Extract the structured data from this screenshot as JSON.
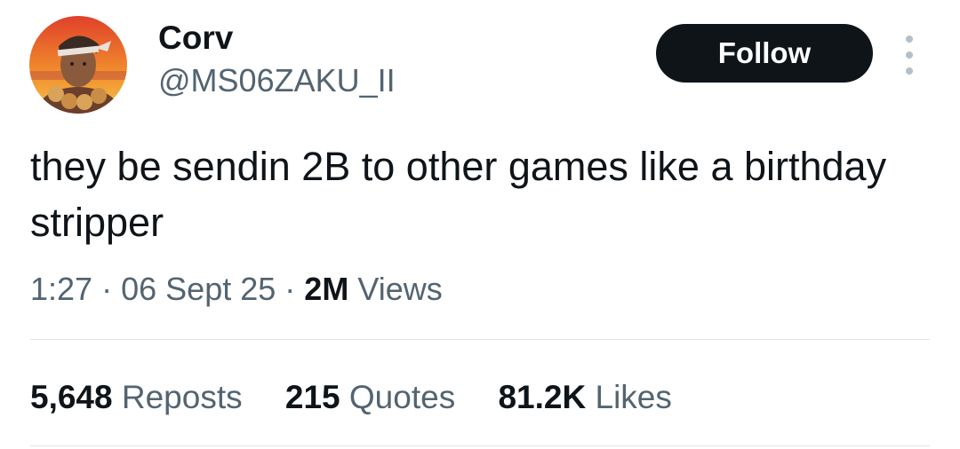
{
  "author": {
    "display_name": "Corv",
    "handle": "@MS06ZAKU_II"
  },
  "follow_button": {
    "label": "Follow"
  },
  "more_icon": "more-vertical-icon",
  "tweet": {
    "text": "they be sendin 2B to other games like a birthday stripper",
    "time": "1:27",
    "separator": "·",
    "date": "06 Sept 25",
    "views_count": "2M",
    "views_label": "Views"
  },
  "stats": [
    {
      "count": "5,648",
      "label": "Reposts"
    },
    {
      "count": "215",
      "label": "Quotes"
    },
    {
      "count": "81.2K",
      "label": "Likes"
    }
  ],
  "colors": {
    "text_primary": "#0f1419",
    "text_secondary": "#536471",
    "button_bg": "#0f1419",
    "divider": "#dde3e8"
  }
}
